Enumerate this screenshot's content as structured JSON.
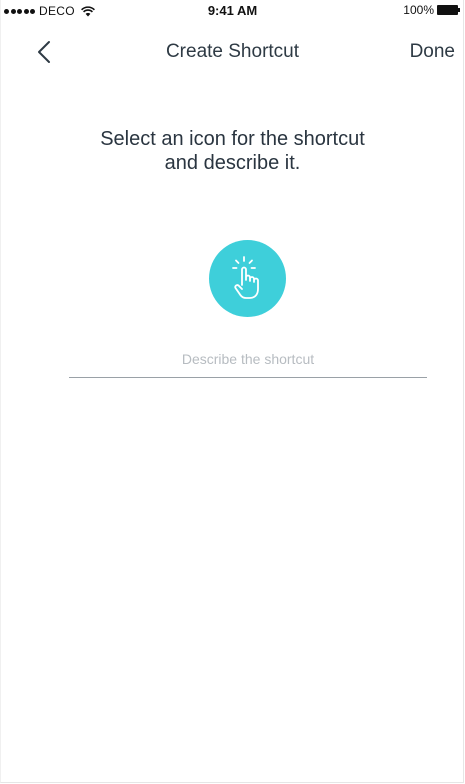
{
  "status_bar": {
    "carrier": "DECO",
    "time": "9:41 AM",
    "battery": "100%"
  },
  "nav": {
    "title": "Create Shortcut",
    "done_label": "Done",
    "back_icon": "chevron-left-icon"
  },
  "content": {
    "headline_line1": "Select an icon for the shortcut",
    "headline_line2": "and describe it.",
    "selected_icon": "tap-hand-icon",
    "describe_placeholder": "Describe the shortcut",
    "describe_value": ""
  },
  "colors": {
    "accent": "#3ecfda",
    "text": "#2e3a44"
  }
}
